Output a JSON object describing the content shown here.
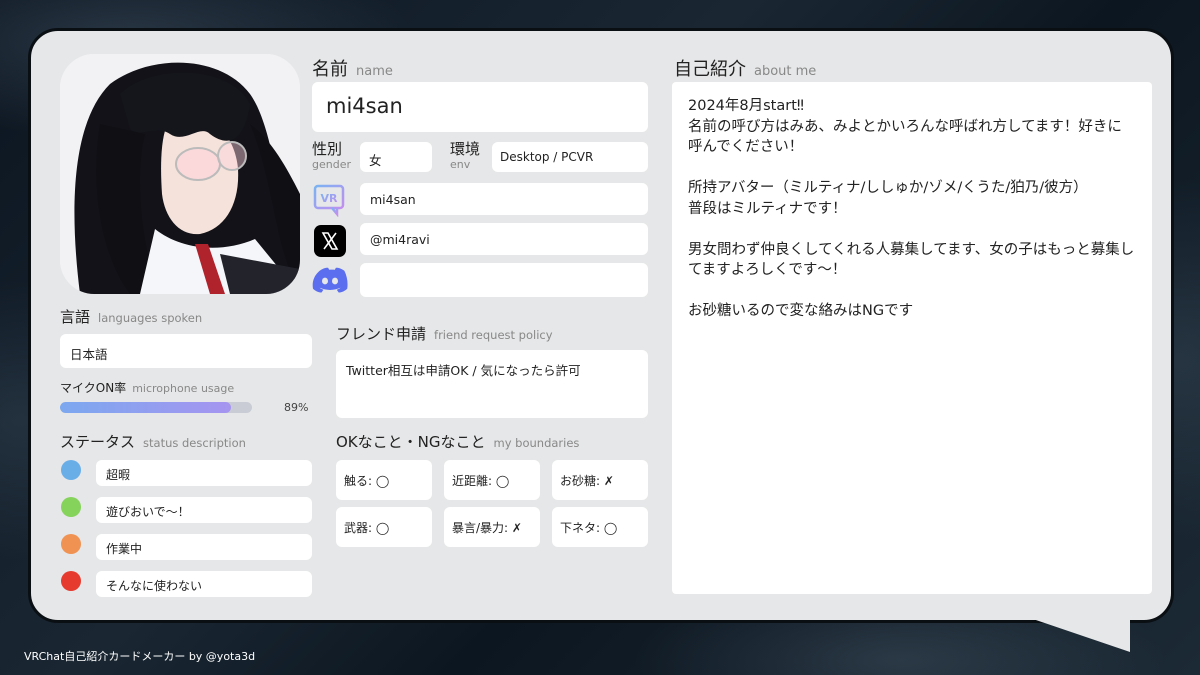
{
  "name_section": {
    "label_jp": "名前",
    "label_en": "name",
    "value": "mi4san"
  },
  "gender": {
    "label_jp": "性別",
    "label_en": "gender",
    "value": "女"
  },
  "env": {
    "label_jp": "環境",
    "label_en": "env",
    "value": "Desktop / PCVR"
  },
  "social": {
    "vrchat": {
      "icon": "vrchat-icon",
      "value": "mi4san"
    },
    "x": {
      "icon": "x-icon",
      "value": "@mi4ravi"
    },
    "discord": {
      "icon": "discord-icon",
      "value": ""
    }
  },
  "languages": {
    "label_jp": "言語",
    "label_en": "languages spoken",
    "value": "日本語"
  },
  "mic": {
    "label_jp": "マイクON率",
    "label_en": "microphone usage",
    "percent": 89,
    "percent_text": "89%"
  },
  "status": {
    "label_jp": "ステータス",
    "label_en": "status description",
    "items": [
      {
        "color": "#6aaee8",
        "text": "超暇"
      },
      {
        "color": "#86d35c",
        "text": "遊びおいで〜！"
      },
      {
        "color": "#f09252",
        "text": "作業中"
      },
      {
        "color": "#e63a2e",
        "text": "そんなに使わない"
      }
    ]
  },
  "friend": {
    "label_jp": "フレンド申請",
    "label_en": "friend request policy",
    "value": "Twitter相互は申請OK / 気になったら許可"
  },
  "boundaries": {
    "label_jp": "OKなこと・NGなこと",
    "label_en": "my boundaries",
    "items": [
      "触る: ◯",
      "近距離: ◯",
      "お砂糖: ✗",
      "武器: ◯",
      "暴言/暴力: ✗",
      "下ネタ: ◯"
    ]
  },
  "about": {
    "label_jp": "自己紹介",
    "label_en": "about me",
    "text": "2024年8月start‼︎\n名前の呼び方はみあ、みよとかいろんな呼ばれ方してます！好きに呼んでください！\n\n所持アバター（ミルティナ/ししゅか/ゾメ/くうた/狛乃/彼方）\n普段はミルティナです！\n\n男女問わず仲良くしてくれる人募集してます、女の子はもっと募集してますよろしくです〜！\n\nお砂糖いるので変な絡みはNGです"
  },
  "footer": "VRChat自己紹介カードメーカー by @yota3d",
  "avatar_image": "avatar-portrait"
}
